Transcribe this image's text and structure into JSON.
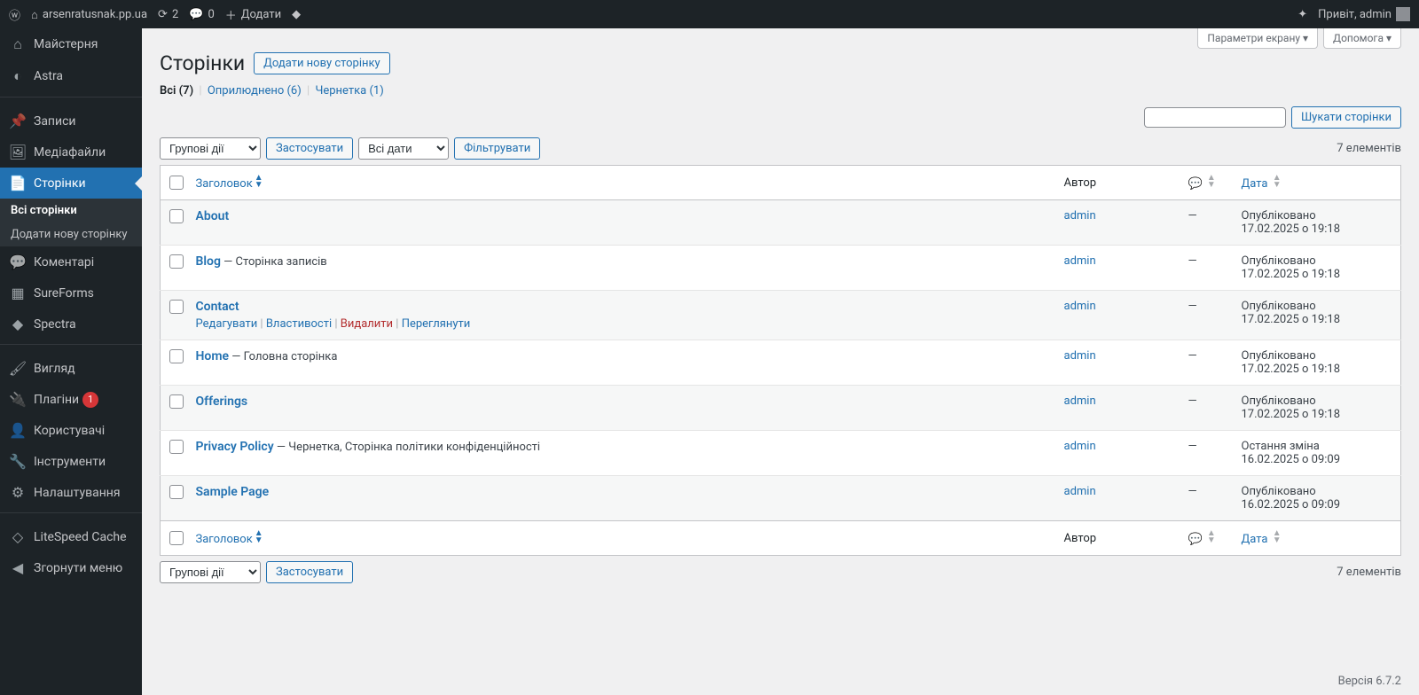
{
  "adminbar": {
    "site_name": "arsenratusnak.pp.ua",
    "updates_count": "2",
    "comments_count": "0",
    "new_label": "Додати",
    "greeting": "Привіт, admin"
  },
  "sidebar": {
    "items": [
      {
        "icon": "dashboard",
        "label": "Майстерня"
      },
      {
        "icon": "astra",
        "label": "Astra"
      },
      {
        "icon": "pin",
        "label": "Записи"
      },
      {
        "icon": "media",
        "label": "Медіафайли"
      },
      {
        "icon": "page",
        "label": "Сторінки",
        "active": true
      },
      {
        "icon": "comments",
        "label": "Коментарі"
      },
      {
        "icon": "sureforms",
        "label": "SureForms"
      },
      {
        "icon": "spectra",
        "label": "Spectra"
      },
      {
        "icon": "appearance",
        "label": "Вигляд"
      },
      {
        "icon": "plugins",
        "label": "Плагіни",
        "badge": "1"
      },
      {
        "icon": "users",
        "label": "Користувачі"
      },
      {
        "icon": "tools",
        "label": "Інструменти"
      },
      {
        "icon": "settings",
        "label": "Налаштування"
      },
      {
        "icon": "litespeed",
        "label": "LiteSpeed Cache"
      },
      {
        "icon": "collapse",
        "label": "Згорнути меню"
      }
    ],
    "submenu": {
      "current": "Всі сторінки",
      "add_new": "Додати нову сторінку"
    }
  },
  "screen_meta": {
    "screen_options": "Параметри екрану",
    "help": "Допомога"
  },
  "heading": "Сторінки",
  "add_new_btn": "Додати нову сторінку",
  "filters": {
    "all": "Всі",
    "all_count": "(7)",
    "published": "Оприлюднено",
    "published_count": "(6)",
    "draft": "Чернетка",
    "draft_count": "(1)"
  },
  "search": {
    "button": "Шукати сторінки",
    "placeholder": ""
  },
  "tablenav": {
    "bulk_actions": "Групові дії",
    "apply": "Застосувати",
    "all_dates": "Всі дати",
    "filter": "Фільтрувати",
    "count": "7 елементів"
  },
  "columns": {
    "title": "Заголовок",
    "author": "Автор",
    "date": "Дата"
  },
  "row_actions": {
    "edit": "Редагувати",
    "quick_edit": "Властивості",
    "trash": "Видалити",
    "view": "Переглянути"
  },
  "pages": [
    {
      "title": "About",
      "state": "",
      "author": "admin",
      "comments": "—",
      "date_status": "Опубліковано",
      "date_time": "17.02.2025 о 19:18",
      "hover": false
    },
    {
      "title": "Blog",
      "state": " — Сторінка записів",
      "author": "admin",
      "comments": "—",
      "date_status": "Опубліковано",
      "date_time": "17.02.2025 о 19:18",
      "hover": false
    },
    {
      "title": "Contact",
      "state": "",
      "author": "admin",
      "comments": "—",
      "date_status": "Опубліковано",
      "date_time": "17.02.2025 о 19:18",
      "hover": true
    },
    {
      "title": "Home",
      "state": " — Головна сторінка",
      "author": "admin",
      "comments": "—",
      "date_status": "Опубліковано",
      "date_time": "17.02.2025 о 19:18",
      "hover": false
    },
    {
      "title": "Offerings",
      "state": "",
      "author": "admin",
      "comments": "—",
      "date_status": "Опубліковано",
      "date_time": "17.02.2025 о 19:18",
      "hover": false
    },
    {
      "title": "Privacy Policy",
      "state": " — Чернетка, Сторінка політики конфіденційності",
      "author": "admin",
      "comments": "—",
      "date_status": "Остання зміна",
      "date_time": "16.02.2025 о 09:09",
      "hover": false
    },
    {
      "title": "Sample Page",
      "state": "",
      "author": "admin",
      "comments": "—",
      "date_status": "Опубліковано",
      "date_time": "16.02.2025 о 09:09",
      "hover": false
    }
  ],
  "footer": {
    "version": "Версія 6.7.2"
  },
  "icons_map": {
    "dashboard": "⌂",
    "astra": "◐",
    "pin": "📌",
    "media": "🖼",
    "page": "📄",
    "comments": "💬",
    "sureforms": "▦",
    "spectra": "◆",
    "appearance": "🖌",
    "plugins": "🔌",
    "users": "👤",
    "tools": "🔧",
    "settings": "⚙",
    "litespeed": "◇",
    "collapse": "◀"
  }
}
